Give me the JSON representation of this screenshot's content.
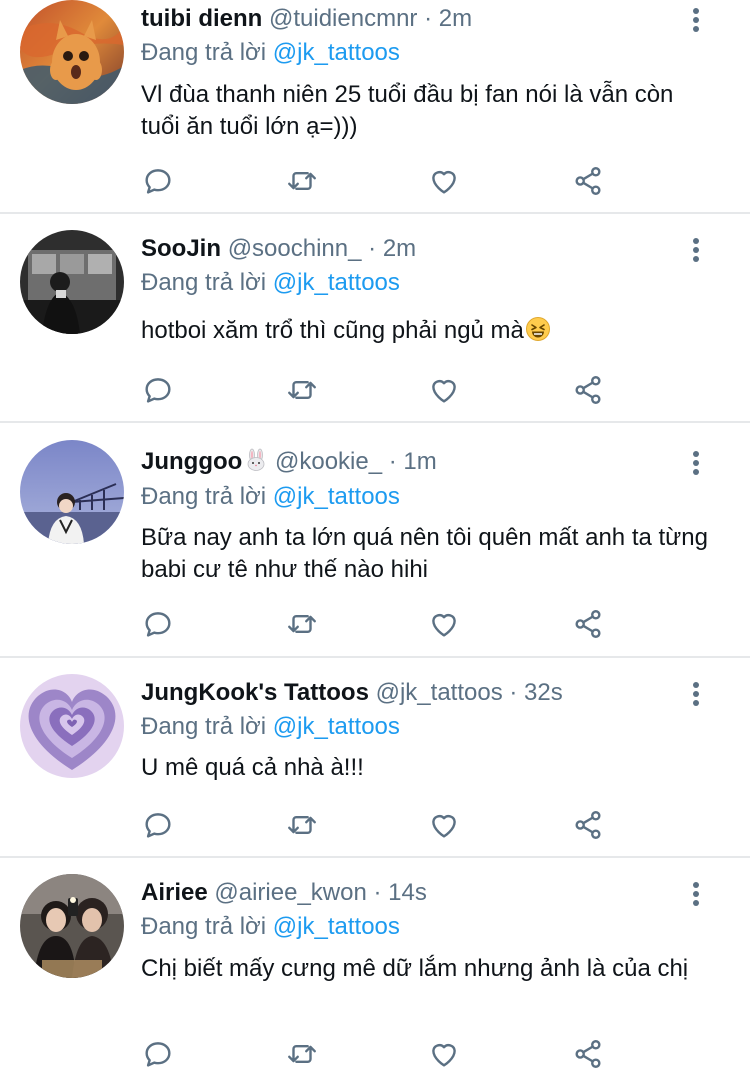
{
  "reply_prefix": "Đang trả lời",
  "tweets": [
    {
      "display_name": "tuibi dienn",
      "handle": "@tuidiencmnr",
      "separator": "·",
      "time": "2m",
      "reply_to": "@jk_tattoos",
      "text": "Vl đùa thanh niên 25 tuổi đầu bị fan nói là vẫn còn tuổi ăn tuổi lớn ạ=)))",
      "avatar_icon": "scream-cat-avatar"
    },
    {
      "display_name": "SooJin",
      "handle": "@soochinn_",
      "separator": "·",
      "time": "2m",
      "reply_to": "@jk_tattoos",
      "text": "hotboi xăm trổ thì cũng phải ngủ mà",
      "trailing_emoji": "grinning-squinting-face",
      "avatar_icon": "photo-avatar-dark"
    },
    {
      "display_name": "Junggoo",
      "name_emoji": "rabbit-face",
      "handle": "@kookie_",
      "separator": "·",
      "time": "1m",
      "reply_to": "@jk_tattoos",
      "text": "Bữa nay anh ta lớn quá nên tôi quên mất anh ta từng babi cư tê như thế nào hihi",
      "avatar_icon": "photo-avatar-bridge"
    },
    {
      "display_name": "JungKook's Tattoos",
      "handle": "@jk_tattoos",
      "separator": "·",
      "time": "32s",
      "reply_to": "@jk_tattoos",
      "text": "U mê quá cả nhà à!!!",
      "avatar_icon": "purple-heart-avatar"
    },
    {
      "display_name": "Airiee",
      "handle": "@airiee_kwon",
      "separator": "·",
      "time": "14s",
      "reply_to": "@jk_tattoos",
      "text": "Chị biết mấy cưng mê dữ lắm nhưng ảnh là của chị",
      "avatar_icon": "photo-avatar-selfie"
    }
  ],
  "colors": {
    "text_primary": "#0f1419",
    "text_secondary": "#5b7083",
    "link": "#1d9bf0",
    "divider": "#e6e8ea"
  },
  "action_icons": [
    "reply-icon",
    "retweet-icon",
    "like-icon",
    "share-icon"
  ]
}
